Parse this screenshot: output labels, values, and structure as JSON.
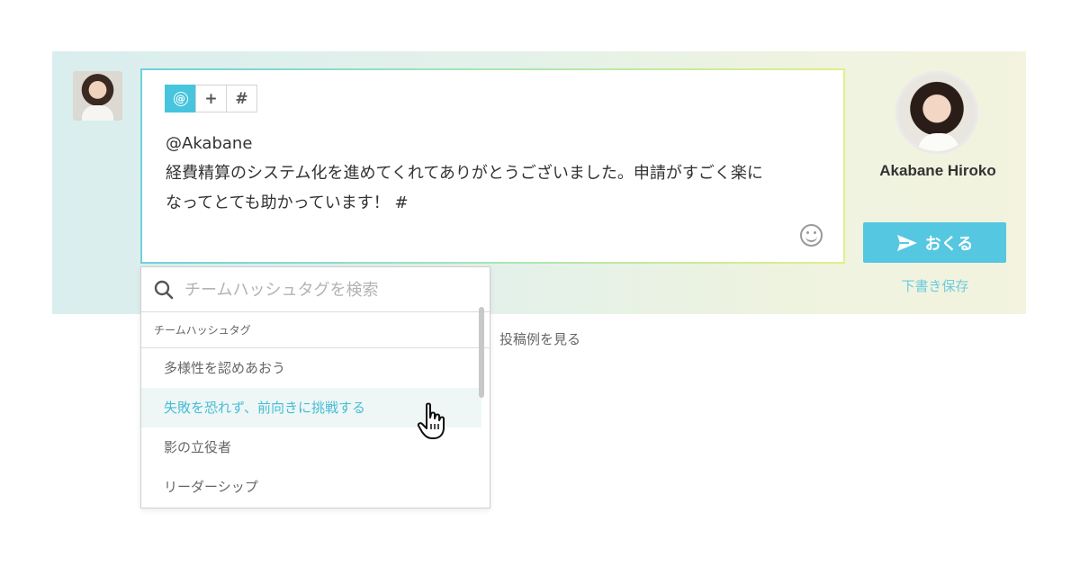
{
  "composer": {
    "toolbar": [
      {
        "symbol": "@",
        "icon": "mention-icon",
        "active": true
      },
      {
        "symbol": "+",
        "icon": "plus-icon",
        "active": false
      },
      {
        "symbol": "#",
        "icon": "hashtag-icon",
        "active": false
      }
    ],
    "mention": "@Akabane",
    "message_line1": "経費精算のシステム化を進めてくれてありがとうございました。申請がすごく楽に",
    "message_line2": "なってとても助かっています！ #"
  },
  "recipient": {
    "name": "Akabane Hiroko"
  },
  "actions": {
    "send_label": "おくる",
    "draft_label": "下書き保存",
    "examples_label": "投稿例を見る"
  },
  "hashtag_dropdown": {
    "search_placeholder": "チームハッシュタグを検索",
    "section_title": "チームハッシュタグ",
    "items": [
      {
        "label": "多様性を認めあおう"
      },
      {
        "label": "失敗を恐れず、前向きに挑戦する"
      },
      {
        "label": "影の立役者"
      },
      {
        "label": "リーダーシップ"
      }
    ],
    "hovered_index": 1
  },
  "colors": {
    "accent": "#56c7e1",
    "hover_text": "#47bcd6",
    "hover_bg": "#eef7f6"
  }
}
